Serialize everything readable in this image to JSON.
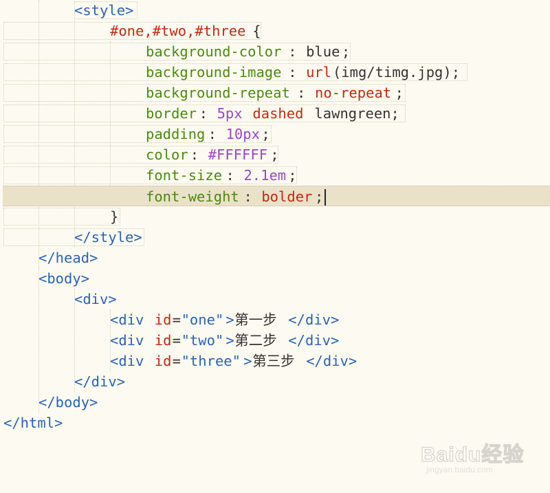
{
  "lines": [
    [
      {
        "t": "<style>",
        "c": "tag"
      }
    ],
    [
      {
        "t": "#one,#two,#three",
        "c": "sel"
      },
      {
        "t": "{",
        "c": "pl"
      }
    ],
    [
      {
        "t": "background-color",
        "c": "prop"
      },
      {
        "t": ": ",
        "c": "pl"
      },
      {
        "t": "blue",
        "c": "pl"
      },
      {
        "t": ";",
        "c": "pl"
      }
    ],
    [
      {
        "t": "background-image",
        "c": "prop"
      },
      {
        "t": ": ",
        "c": "pl"
      },
      {
        "t": "url",
        "c": "val"
      },
      {
        "t": "(img/timg.jpg);",
        "c": "pl"
      }
    ],
    [
      {
        "t": "background-repeat",
        "c": "prop"
      },
      {
        "t": ": ",
        "c": "pl"
      },
      {
        "t": "no-repeat",
        "c": "val"
      },
      {
        "t": ";",
        "c": "pl"
      }
    ],
    [
      {
        "t": "border",
        "c": "prop"
      },
      {
        "t": ": ",
        "c": "pl"
      },
      {
        "t": "5px",
        "c": "num"
      },
      {
        "t": " ",
        "c": "pl"
      },
      {
        "t": "dashed",
        "c": "val"
      },
      {
        "t": " lawngreen;",
        "c": "pl"
      }
    ],
    [
      {
        "t": "padding",
        "c": "prop"
      },
      {
        "t": ": ",
        "c": "pl"
      },
      {
        "t": "10px",
        "c": "num"
      },
      {
        "t": ";",
        "c": "pl"
      }
    ],
    [
      {
        "t": "color",
        "c": "prop"
      },
      {
        "t": ": ",
        "c": "pl"
      },
      {
        "t": "#FFFFFF",
        "c": "num"
      },
      {
        "t": ";",
        "c": "pl"
      }
    ],
    [
      {
        "t": "font-size",
        "c": "prop"
      },
      {
        "t": ": ",
        "c": "pl"
      },
      {
        "t": "2.1em",
        "c": "num"
      },
      {
        "t": ";",
        "c": "pl"
      }
    ],
    [
      {
        "t": "font-weight",
        "c": "prop"
      },
      {
        "t": ": ",
        "c": "pl"
      },
      {
        "t": "bolder",
        "c": "val"
      },
      {
        "t": ";",
        "c": "pl"
      }
    ],
    [
      {
        "t": "}",
        "c": "pl"
      }
    ],
    [
      {
        "t": "</style>",
        "c": "tag"
      }
    ],
    [
      {
        "t": "</head>",
        "c": "tag"
      }
    ],
    [
      {
        "t": "<body>",
        "c": "tag"
      }
    ],
    [
      {
        "t": "<div>",
        "c": "tag"
      }
    ],
    [
      {
        "t": "<div ",
        "c": "tag"
      },
      {
        "t": "id",
        "c": "attr"
      },
      {
        "t": "=",
        "c": "pl"
      },
      {
        "t": "\"one\"",
        "c": "str"
      },
      {
        "t": ">",
        "c": "tag"
      },
      {
        "t": "第一步",
        "c": "txt"
      },
      {
        "t": "</div>",
        "c": "tag"
      }
    ],
    [
      {
        "t": "<div ",
        "c": "tag"
      },
      {
        "t": "id",
        "c": "attr"
      },
      {
        "t": "=",
        "c": "pl"
      },
      {
        "t": "\"two\"",
        "c": "str"
      },
      {
        "t": ">",
        "c": "tag"
      },
      {
        "t": "第二步",
        "c": "txt"
      },
      {
        "t": "</div>",
        "c": "tag"
      }
    ],
    [
      {
        "t": "<div ",
        "c": "tag"
      },
      {
        "t": "id",
        "c": "attr"
      },
      {
        "t": "=",
        "c": "pl"
      },
      {
        "t": "\"three\"",
        "c": "str"
      },
      {
        "t": ">",
        "c": "tag"
      },
      {
        "t": "第三步",
        "c": "txt"
      },
      {
        "t": "</div>",
        "c": "tag"
      }
    ],
    [
      {
        "t": "</div>",
        "c": "tag"
      }
    ],
    [
      {
        "t": "</body>",
        "c": "tag"
      }
    ],
    [
      {
        "t": "</html>",
        "c": "tag"
      }
    ]
  ],
  "current_line": 10,
  "watermark": {
    "brand": "Baidu经验",
    "url": "jingyan.baidu.com"
  }
}
